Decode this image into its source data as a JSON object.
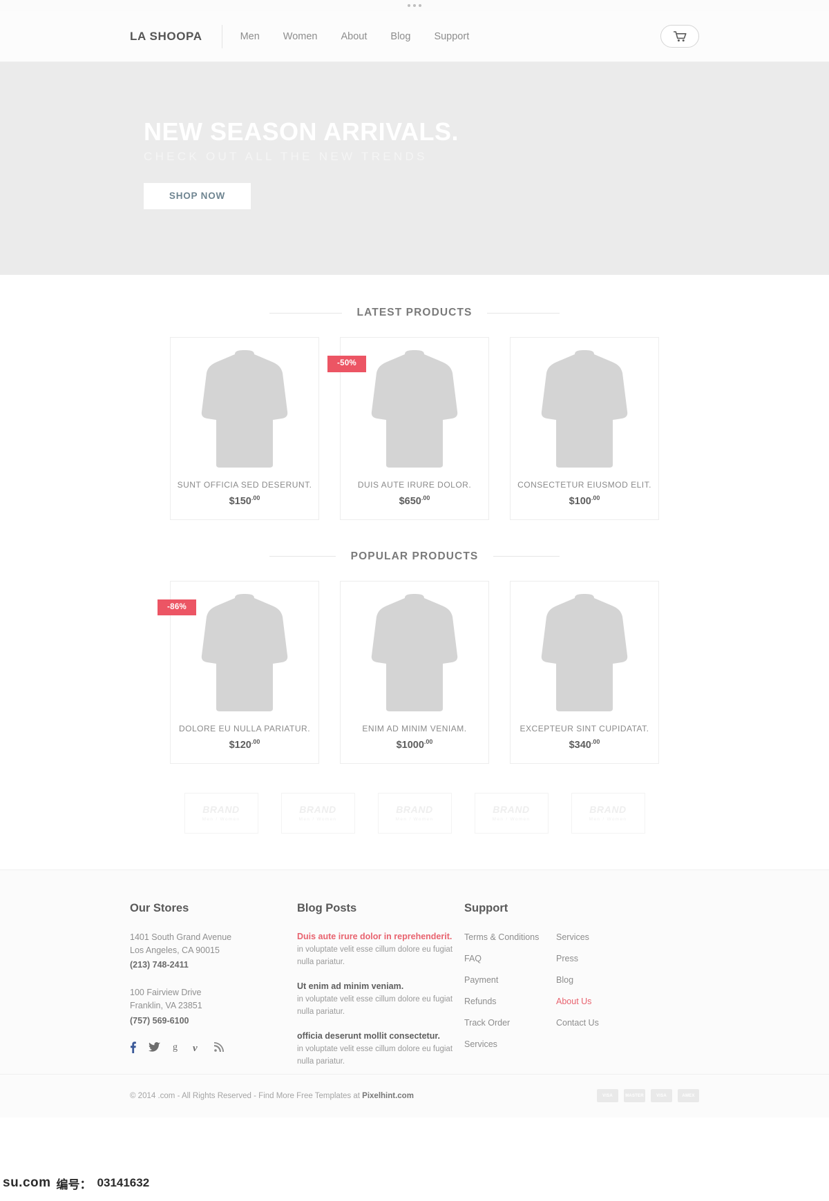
{
  "browser": {
    "dots": 3
  },
  "header": {
    "logo": "LA SHOOPA",
    "nav": [
      {
        "label": "Men"
      },
      {
        "label": "Women"
      },
      {
        "label": "About"
      },
      {
        "label": "Blog"
      },
      {
        "label": "Support"
      }
    ],
    "cart_icon": "shopping-cart-icon"
  },
  "hero": {
    "title": "NEW SEASON ARRIVALS.",
    "subtitle": "CHECK OUT ALL THE NEW TRENDS",
    "cta": "SHOP NOW",
    "cta_color": "#6f8591",
    "bg_color": "#ebebeb"
  },
  "sections": {
    "latest_title": "LATEST PRODUCTS",
    "popular_title": "POPULAR PRODUCTS"
  },
  "badge_color": "#ec5564",
  "latest_products": [
    {
      "name": "SUNT OFFICIA SED DESERUNT.",
      "price": "$150",
      "cents": ".00",
      "badge": ""
    },
    {
      "name": "DUIS AUTE IRURE DOLOR.",
      "price": "$650",
      "cents": ".00",
      "badge": "-50%"
    },
    {
      "name": "CONSECTETUR EIUSMOD ELIT.",
      "price": "$100",
      "cents": ".00",
      "badge": ""
    }
  ],
  "popular_products": [
    {
      "name": "DOLORE EU NULLA PARIATUR.",
      "price": "$120",
      "cents": ".00",
      "badge": "-86%"
    },
    {
      "name": "ENIM AD MINIM VENIAM.",
      "price": "$1000",
      "cents": ".00",
      "badge": ""
    },
    {
      "name": "EXCEPTEUR SINT CUPIDATAT.",
      "price": "$340",
      "cents": ".00",
      "badge": ""
    }
  ],
  "brands": [
    {
      "name": "BRAND",
      "sub": "Men / Women"
    },
    {
      "name": "BRAND",
      "sub": "Men / Women"
    },
    {
      "name": "BRAND",
      "sub": "Men / Women"
    },
    {
      "name": "BRAND",
      "sub": "Men / Women"
    },
    {
      "name": "BRAND",
      "sub": "Men / Women"
    }
  ],
  "footer": {
    "stores": {
      "heading": "Our Stores",
      "items": [
        {
          "line1": "1401 South Grand Avenue",
          "line2": "Los Angeles, CA 90015",
          "phone": "(213) 748-2411"
        },
        {
          "line1": "100 Fairview Drive",
          "line2": "Franklin, VA 23851",
          "phone": "(757) 569-6100"
        }
      ],
      "social": [
        "facebook-icon",
        "twitter-icon",
        "google-plus-icon",
        "vimeo-icon",
        "rss-icon"
      ]
    },
    "blog": {
      "heading": "Blog Posts",
      "posts": [
        {
          "title": "Duis aute irure dolor in reprehenderit.",
          "excerpt": " in voluptate velit esse cillum dolore eu fugiat nulla pariatur.",
          "featured": true
        },
        {
          "title": "Ut enim ad minim veniam.",
          "excerpt": " in voluptate velit esse cillum dolore eu fugiat nulla pariatur.",
          "featured": false
        },
        {
          "title": "officia deserunt mollit consectetur.",
          "excerpt": " in voluptate velit esse cillum dolore eu fugiat nulla pariatur.",
          "featured": false
        }
      ]
    },
    "support": {
      "heading": "Support",
      "col1": [
        {
          "label": "Terms & Conditions",
          "highlight": false
        },
        {
          "label": "FAQ",
          "highlight": false
        },
        {
          "label": "Payment",
          "highlight": false
        },
        {
          "label": "Refunds",
          "highlight": false
        },
        {
          "label": "Track Order",
          "highlight": false
        },
        {
          "label": "Services",
          "highlight": false
        }
      ],
      "col2": [
        {
          "label": "Services",
          "highlight": false
        },
        {
          "label": "Press",
          "highlight": false
        },
        {
          "label": "Blog",
          "highlight": false
        },
        {
          "label": "About Us",
          "highlight": true
        },
        {
          "label": "Contact Us",
          "highlight": false
        }
      ]
    }
  },
  "bottom": {
    "copyright_pre": "© 2014 ",
    "copyright_mid": ".com - All Rights Reserved - Find More Free Templates at ",
    "copyright_brand": "Pixelhint.com",
    "payments": [
      "VISA",
      "MASTER",
      "VISA",
      "AMEX"
    ]
  },
  "watermark": {
    "site": "su.com",
    "label": "编号：",
    "code": "03141632"
  }
}
